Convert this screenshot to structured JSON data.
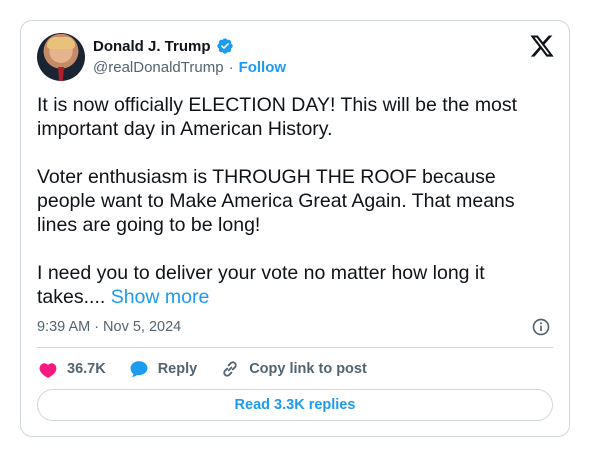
{
  "author": {
    "name": "Donald J. Trump",
    "handle": "@realDonaldTrump",
    "separator": "·",
    "follow_label": "Follow"
  },
  "post": {
    "paragraph_1": "It is now officially ELECTION DAY! This will be the most important day in American History.",
    "paragraph_2": "Voter enthusiasm is THROUGH THE ROOF because people want to Make America Great Again. That means lines are going to be long!",
    "paragraph_3": "I need you to deliver your vote no matter how long it takes....",
    "show_more_label": "Show more"
  },
  "meta": {
    "time": "9:39 AM",
    "separator": "·",
    "date": "Nov 5, 2024"
  },
  "actions": {
    "like_count": "36.7K",
    "reply_label": "Reply",
    "copy_link_label": "Copy link to post"
  },
  "read_replies_label": "Read 3.3K replies",
  "colors": {
    "accent": "#1d9bf0",
    "like": "#f91880",
    "text": "#0f1419",
    "muted": "#536471",
    "border": "#cfd9de"
  },
  "icons": {
    "verified": "verified-badge-icon",
    "logo": "x-logo-icon",
    "info": "info-icon",
    "like": "heart-icon",
    "reply": "speech-bubble-icon",
    "copy": "link-icon"
  }
}
